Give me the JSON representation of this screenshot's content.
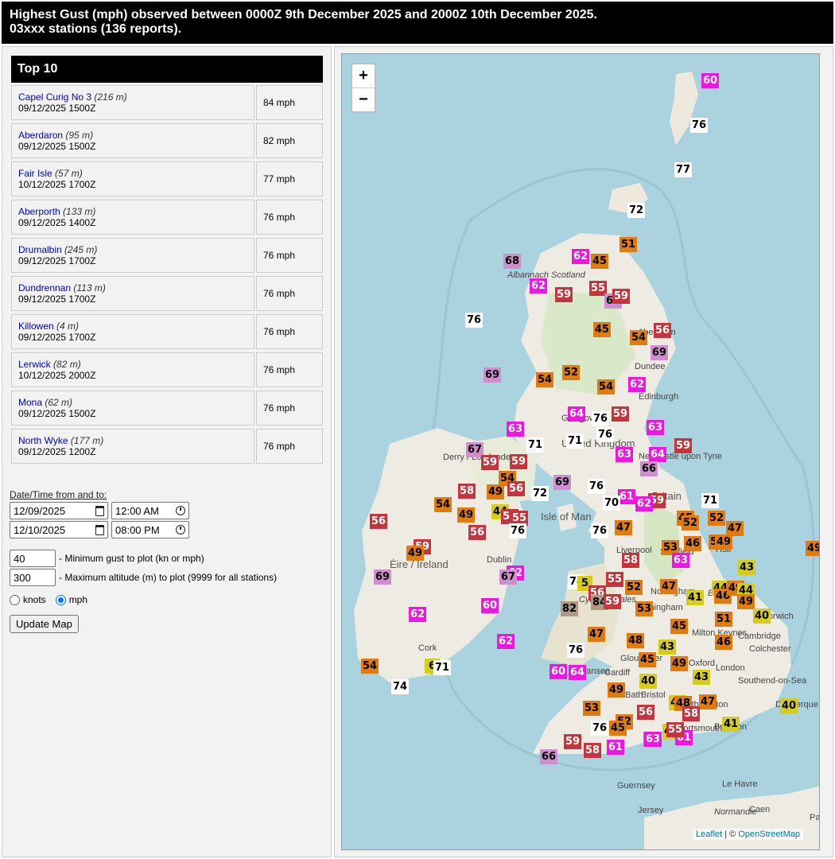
{
  "header": {
    "line1": "Highest Gust (mph) observed between 0000Z 9th December 2025 and 2000Z 10th December 2025.",
    "line2": "03xxx stations (136 reports)."
  },
  "top10": {
    "title": "Top 10",
    "rows": [
      {
        "name": "Capel Curig No 3",
        "alt": "(216 m)",
        "time": "09/12/2025 1500Z",
        "value": "84 mph"
      },
      {
        "name": "Aberdaron",
        "alt": "(95 m)",
        "time": "09/12/2025 1500Z",
        "value": "82 mph"
      },
      {
        "name": "Fair Isle",
        "alt": "(57 m)",
        "time": "10/12/2025 1700Z",
        "value": "77 mph"
      },
      {
        "name": "Aberporth",
        "alt": "(133 m)",
        "time": "09/12/2025 1400Z",
        "value": "76 mph"
      },
      {
        "name": "Drumalbin",
        "alt": "(245 m)",
        "time": "09/12/2025 1700Z",
        "value": "76 mph"
      },
      {
        "name": "Dundrennan",
        "alt": "(113 m)",
        "time": "09/12/2025 1700Z",
        "value": "76 mph"
      },
      {
        "name": "Killowen",
        "alt": "(4 m)",
        "time": "09/12/2025 1700Z",
        "value": "76 mph"
      },
      {
        "name": "Lerwick",
        "alt": "(82 m)",
        "time": "10/12/2025 2000Z",
        "value": "76 mph"
      },
      {
        "name": "Mona",
        "alt": "(62 m)",
        "time": "09/12/2025 1500Z",
        "value": "76 mph"
      },
      {
        "name": "North Wyke",
        "alt": "(177 m)",
        "time": "09/12/2025 1200Z",
        "value": "76 mph"
      }
    ]
  },
  "form": {
    "datetime_label": "Date/Time from and to:",
    "from_date": "12/09/2025",
    "from_time": "12:00 AM",
    "to_date": "12/10/2025",
    "to_time": "08:00 PM",
    "min_gust": "40",
    "min_gust_label": "- Minimum gust to plot (kn or mph)",
    "max_alt": "300",
    "max_alt_label": "- Maximum altitude (m) to plot (9999 for all stations)",
    "unit_knots": "knots",
    "unit_mph": "mph",
    "selected_unit": "mph",
    "update_button": "Update Map"
  },
  "map": {
    "zoom_in": "+",
    "zoom_out": "−",
    "attribution_leaflet": "Leaflet",
    "attribution_sep": " | © ",
    "attribution_osm": "OpenStreetMap",
    "colors": {
      "40-44": "#d4cd1d",
      "45-54": "#e07b12",
      "55-59": "#c4363e",
      "60-64": "#ee16e1",
      "65-69": "#cf8fcf",
      "70-79": "#ffffff",
      "80+": "#b09a85"
    },
    "places": [
      {
        "name": "Albannach Scotland"
      },
      {
        "name": "Aberdeen"
      },
      {
        "name": "Dundee"
      },
      {
        "name": "Edinburgh"
      },
      {
        "name": "Glasgow"
      },
      {
        "name": "United Kingdom"
      },
      {
        "name": "Newcastle upon Tyne"
      },
      {
        "name": "Derry / Londonderry"
      },
      {
        "name": "Isle of Man"
      },
      {
        "name": "Britain"
      },
      {
        "name": "Éire / Ireland"
      },
      {
        "name": "Dublin"
      },
      {
        "name": "Hull"
      },
      {
        "name": "Sheffield"
      },
      {
        "name": "Liverpool"
      },
      {
        "name": "Nottingham"
      },
      {
        "name": "Birmingham"
      },
      {
        "name": "England"
      },
      {
        "name": "Norwich"
      },
      {
        "name": "Cambridge"
      },
      {
        "name": "Colchester"
      },
      {
        "name": "Milton Keynes"
      },
      {
        "name": "Oxford"
      },
      {
        "name": "London"
      },
      {
        "name": "Southend-on-Sea"
      },
      {
        "name": "Dunkerque"
      },
      {
        "name": "Gloucester"
      },
      {
        "name": "Cardiff"
      },
      {
        "name": "Bath"
      },
      {
        "name": "Bristol"
      },
      {
        "name": "Southampton"
      },
      {
        "name": "Portsmouth"
      },
      {
        "name": "Brighton"
      },
      {
        "name": "Swansea"
      },
      {
        "name": "Cymru / Wales"
      },
      {
        "name": "Cork"
      },
      {
        "name": "Guernsey"
      },
      {
        "name": "Jersey"
      },
      {
        "name": "Le Havre"
      },
      {
        "name": "Caen"
      },
      {
        "name": "Normandie"
      },
      {
        "name": "Pa"
      }
    ],
    "markers": [
      {
        "v": "60"
      },
      {
        "v": "76"
      },
      {
        "v": "77"
      },
      {
        "v": "72"
      },
      {
        "v": "51"
      },
      {
        "v": "62"
      },
      {
        "v": "45"
      },
      {
        "v": "68"
      },
      {
        "v": "62"
      },
      {
        "v": "59"
      },
      {
        "v": "55"
      },
      {
        "v": "67"
      },
      {
        "v": "59"
      },
      {
        "v": "76"
      },
      {
        "v": "45"
      },
      {
        "v": "54"
      },
      {
        "v": "56"
      },
      {
        "v": "69"
      },
      {
        "v": "54"
      },
      {
        "v": "52"
      },
      {
        "v": "69"
      },
      {
        "v": "54"
      },
      {
        "v": "62"
      },
      {
        "v": "64"
      },
      {
        "v": "76"
      },
      {
        "v": "59"
      },
      {
        "v": "63"
      },
      {
        "v": "63"
      },
      {
        "v": "76"
      },
      {
        "v": "71"
      },
      {
        "v": "71"
      },
      {
        "v": "63"
      },
      {
        "v": "64"
      },
      {
        "v": "59"
      },
      {
        "v": "66"
      },
      {
        "v": "67"
      },
      {
        "v": "59"
      },
      {
        "v": "59"
      },
      {
        "v": "54"
      },
      {
        "v": "49"
      },
      {
        "v": "58"
      },
      {
        "v": "56"
      },
      {
        "v": "72"
      },
      {
        "v": "69"
      },
      {
        "v": "76"
      },
      {
        "v": "61"
      },
      {
        "v": "59"
      },
      {
        "v": "71"
      },
      {
        "v": "70"
      },
      {
        "v": "62"
      },
      {
        "v": "54"
      },
      {
        "v": "49"
      },
      {
        "v": "44"
      },
      {
        "v": "56"
      },
      {
        "v": "55"
      },
      {
        "v": "45"
      },
      {
        "v": "52"
      },
      {
        "v": "52"
      },
      {
        "v": "56"
      },
      {
        "v": "56"
      },
      {
        "v": "76"
      },
      {
        "v": "76"
      },
      {
        "v": "47"
      },
      {
        "v": "47"
      },
      {
        "v": "59"
      },
      {
        "v": "49"
      },
      {
        "v": "52"
      },
      {
        "v": "53"
      },
      {
        "v": "46"
      },
      {
        "v": "49"
      },
      {
        "v": "69"
      },
      {
        "v": "49"
      },
      {
        "v": "58"
      },
      {
        "v": "63"
      },
      {
        "v": "62"
      },
      {
        "v": "67"
      },
      {
        "v": "74"
      },
      {
        "v": "55"
      },
      {
        "v": "5"
      },
      {
        "v": "52"
      },
      {
        "v": "47"
      },
      {
        "v": "43"
      },
      {
        "v": "44"
      },
      {
        "v": "56"
      },
      {
        "v": "84"
      },
      {
        "v": "41"
      },
      {
        "v": "46"
      },
      {
        "v": "49"
      },
      {
        "v": "44"
      },
      {
        "v": "59"
      },
      {
        "v": "53"
      },
      {
        "v": "49"
      },
      {
        "v": "60"
      },
      {
        "v": "82"
      },
      {
        "v": "62"
      },
      {
        "v": "40"
      },
      {
        "v": "51"
      },
      {
        "v": "45"
      },
      {
        "v": "47"
      },
      {
        "v": "62"
      },
      {
        "v": "48"
      },
      {
        "v": "43"
      },
      {
        "v": "46"
      },
      {
        "v": "76"
      },
      {
        "v": "45"
      },
      {
        "v": "49"
      },
      {
        "v": "54"
      },
      {
        "v": "6"
      },
      {
        "v": "71"
      },
      {
        "v": "60"
      },
      {
        "v": "64"
      },
      {
        "v": "40"
      },
      {
        "v": "43"
      },
      {
        "v": "49"
      },
      {
        "v": "74"
      },
      {
        "v": "47"
      },
      {
        "v": "44"
      },
      {
        "v": "48"
      },
      {
        "v": "53"
      },
      {
        "v": "40"
      },
      {
        "v": "56"
      },
      {
        "v": "58"
      },
      {
        "v": "52"
      },
      {
        "v": "76"
      },
      {
        "v": "45"
      },
      {
        "v": "41"
      },
      {
        "v": "44"
      },
      {
        "v": "61"
      },
      {
        "v": "49"
      },
      {
        "v": "55"
      },
      {
        "v": "63"
      },
      {
        "v": "61"
      },
      {
        "v": "59"
      },
      {
        "v": "58"
      },
      {
        "v": "66"
      }
    ]
  }
}
